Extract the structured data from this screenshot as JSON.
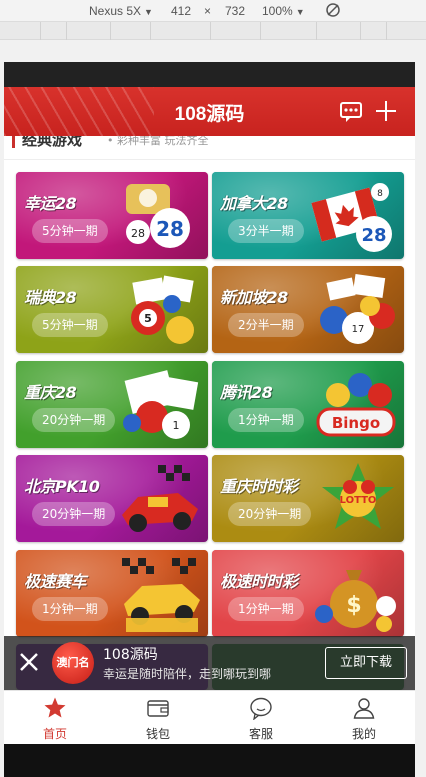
{
  "devtools": {
    "device": "Nexus 5X",
    "width": "412",
    "times": "×",
    "height": "732",
    "zoom": "100%"
  },
  "header": {
    "title": "108源码"
  },
  "section": {
    "title": "经典游戏",
    "subtitle": "• 彩种丰富 玩法齐全"
  },
  "games": [
    {
      "name": "幸运28",
      "period": "5分钟一期",
      "bg": "#c2177a"
    },
    {
      "name": "加拿大28",
      "period": "3分半一期",
      "bg": "#149e92"
    },
    {
      "name": "瑞典28",
      "period": "5分钟一期",
      "bg": "#8ea318"
    },
    {
      "name": "新加坡28",
      "period": "2分半一期",
      "bg": "#b46414"
    },
    {
      "name": "重庆28",
      "period": "20分钟一期",
      "bg": "#42a02c"
    },
    {
      "name": "腾讯28",
      "period": "1分钟一期",
      "bg": "#1f9c4c"
    },
    {
      "name": "北京PK10",
      "period": "20分钟一期",
      "bg": "#a4199a"
    },
    {
      "name": "重庆时时彩",
      "period": "20分钟一期",
      "bg": "#ac8c12"
    },
    {
      "name": "极速赛车",
      "period": "1分钟一期",
      "bg": "#d2531b"
    },
    {
      "name": "极速时时彩",
      "period": "1分钟一期",
      "bg": "#e24448"
    }
  ],
  "banner": {
    "logo_text": "澳门名",
    "title": "108源码",
    "subtitle": "幸运是随时陪伴，走到哪玩到哪",
    "download_label": "立即下载"
  },
  "tabs": [
    {
      "label": "首页",
      "icon": "star-icon"
    },
    {
      "label": "钱包",
      "icon": "wallet-icon"
    },
    {
      "label": "客服",
      "icon": "chat-icon"
    },
    {
      "label": "我的",
      "icon": "user-icon"
    }
  ],
  "colors": {
    "brand": "#c9302c",
    "active_tab": "#d23a31"
  }
}
